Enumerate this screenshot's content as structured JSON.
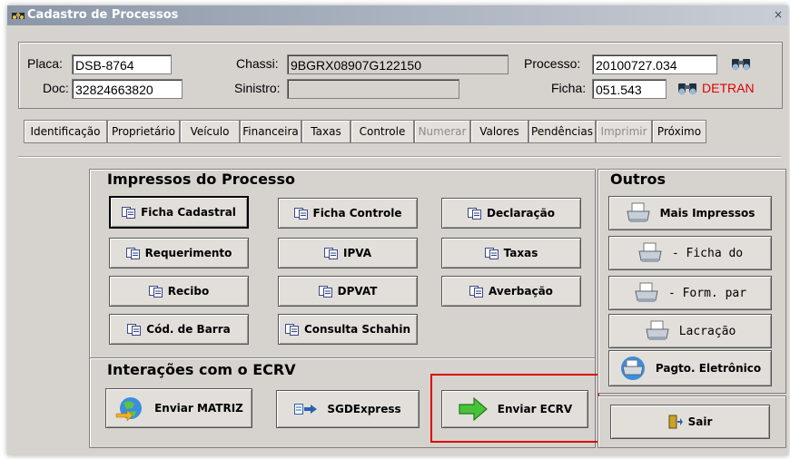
{
  "window": {
    "title": "Cadastro de Processos",
    "close": "×"
  },
  "header": {
    "placa_label": "Placa:",
    "placa_value": "DSB-8764",
    "chassi_label": "Chassi:",
    "chassi_value": "9BGRX08907G122150",
    "processo_label": "Processo:",
    "processo_value": "20100727.034",
    "doc_label": "Doc:",
    "doc_value": "32824663820",
    "sinistro_label": "Sinistro:",
    "sinistro_value": "",
    "ficha_label": "Ficha:",
    "ficha_value": "051.543",
    "detran_label": "DETRAN",
    "detran_color": "#e00000"
  },
  "tabs": [
    {
      "label": "Identificação",
      "enabled": true
    },
    {
      "label": "Proprietário",
      "enabled": true
    },
    {
      "label": "Veículo",
      "enabled": true
    },
    {
      "label": "Financeira",
      "enabled": true
    },
    {
      "label": "Taxas",
      "enabled": true
    },
    {
      "label": "Controle",
      "enabled": true
    },
    {
      "label": "Numerar",
      "enabled": false
    },
    {
      "label": "Valores",
      "enabled": true
    },
    {
      "label": "Pendências",
      "enabled": true
    },
    {
      "label": "Imprimir",
      "enabled": false
    },
    {
      "label": "Próximo",
      "enabled": true
    }
  ],
  "impressos": {
    "title": "Impressos do Processo",
    "buttons": [
      {
        "label": "Ficha Cadastral",
        "icon": "document-copy-icon"
      },
      {
        "label": "Ficha Controle",
        "icon": "document-copy-icon"
      },
      {
        "label": "Declaração",
        "icon": "document-copy-icon"
      },
      {
        "label": "Requerimento",
        "icon": "document-copy-icon"
      },
      {
        "label": "IPVA",
        "icon": "document-copy-icon"
      },
      {
        "label": "Taxas",
        "icon": "document-copy-icon"
      },
      {
        "label": "Recibo",
        "icon": "document-copy-icon"
      },
      {
        "label": "DPVAT",
        "icon": "document-copy-icon"
      },
      {
        "label": "Averbação",
        "icon": "document-copy-icon"
      },
      {
        "label": "Cód. de Barra",
        "icon": "document-copy-icon"
      },
      {
        "label": "Consulta Schahin",
        "icon": "document-copy-icon"
      }
    ]
  },
  "outros": {
    "title": "Outros",
    "buttons": [
      {
        "label": "Mais Impressos",
        "icon": "printer-icon"
      },
      {
        "label": "- Ficha do",
        "icon": "printer-icon"
      },
      {
        "label": "- Form. par",
        "icon": "printer-icon"
      },
      {
        "label": "Lacração",
        "icon": "printer-icon"
      },
      {
        "label": "Pagto. Eletrônico",
        "icon": "printer-globe-icon"
      }
    ]
  },
  "ecrv": {
    "title": "Interações com o ECRV",
    "buttons": [
      {
        "label": "Enviar MATRIZ",
        "icon": "globe-arrow-icon"
      },
      {
        "label": "SGDExpress",
        "icon": "send-arrow-icon"
      },
      {
        "label": "Enviar ECRV",
        "icon": "green-arrow-icon"
      }
    ],
    "highlight_color": "#e00000"
  },
  "sair": {
    "label": "Sair",
    "icon": "exit-door-icon"
  }
}
